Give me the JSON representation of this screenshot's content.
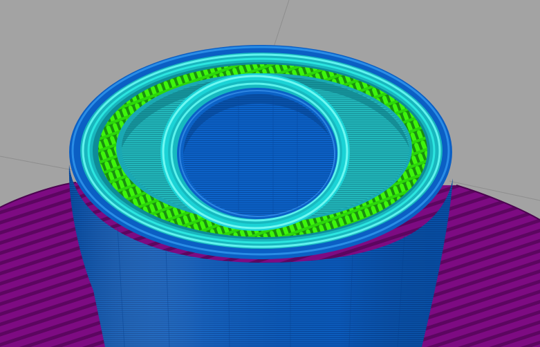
{
  "app": {
    "view": "3d-gcode-preview",
    "background_color": "#a3a3a3"
  },
  "scene": {
    "model": "hollow-cylinder-with-inner-tube",
    "extrusion_roles": [
      {
        "role": "brim-skirt",
        "color": "#7a0a7e",
        "icon": "brim-icon"
      },
      {
        "role": "external-perimeter",
        "color": "#0a5fc2",
        "icon": "perimeter-icon"
      },
      {
        "role": "inner-perimeter",
        "color": "#27e0d8",
        "icon": "perimeter-icon"
      },
      {
        "role": "infill-zigzag",
        "color": "#3ef50b",
        "icon": "infill-icon"
      },
      {
        "role": "solid-infill",
        "color": "#2bc2c2",
        "icon": "infill-icon"
      }
    ]
  }
}
